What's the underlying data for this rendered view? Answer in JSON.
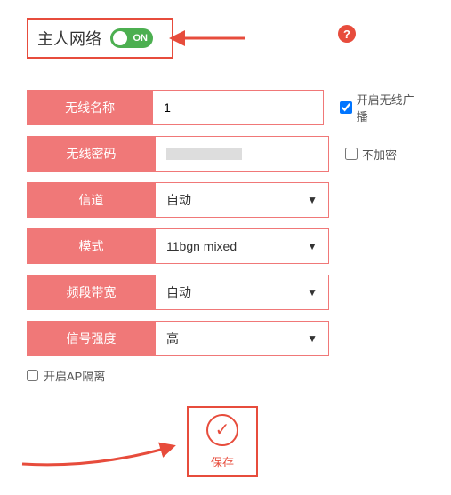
{
  "header": {
    "title": "主人网络",
    "toggle_text": "ON",
    "help_symbol": "?"
  },
  "fields": {
    "ssid": {
      "label": "无线名称",
      "value": "1"
    },
    "pwd": {
      "label": "无线密码",
      "value": ""
    },
    "channel": {
      "label": "信道",
      "value": "自动"
    },
    "mode": {
      "label": "模式",
      "value": "11bgn mixed"
    },
    "bandwidth": {
      "label": "频段带宽",
      "value": "自动"
    },
    "signal": {
      "label": "信号强度",
      "value": "高"
    }
  },
  "side": {
    "broadcast": "开启无线广播",
    "noencrypt": "不加密"
  },
  "ap_isolation": "开启AP隔离",
  "save": "保存",
  "icons": {
    "check": "✓",
    "caret": "▼"
  },
  "colors": {
    "primary": "#f07878",
    "accent": "#e74c3c",
    "toggle": "#4caf50"
  }
}
